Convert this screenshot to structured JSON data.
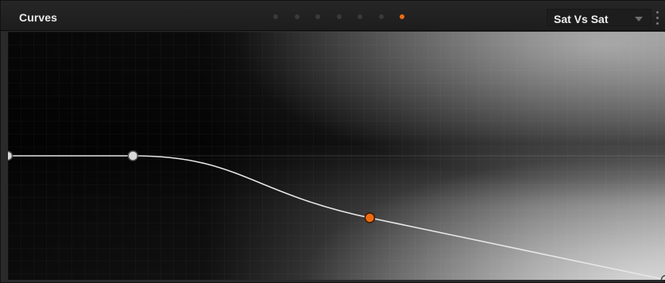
{
  "panel": {
    "title": "Curves",
    "page_dots": {
      "count": 7,
      "active_index": 6
    },
    "mode_dropdown": {
      "selected": "Sat Vs Sat"
    }
  },
  "colors": {
    "accent": "#ee6a12",
    "curve_line": "#e6e6e6",
    "control_point": "#d9d9d9"
  },
  "curve": {
    "control_points": [
      {
        "input": 0.0,
        "output": 0.5,
        "type": "endpoint-left"
      },
      {
        "input": 0.19,
        "output": 0.5,
        "type": "point"
      },
      {
        "input": 0.55,
        "output": 0.25,
        "type": "selected"
      },
      {
        "input": 1.0,
        "output": 0.0,
        "type": "endpoint-right"
      }
    ]
  }
}
